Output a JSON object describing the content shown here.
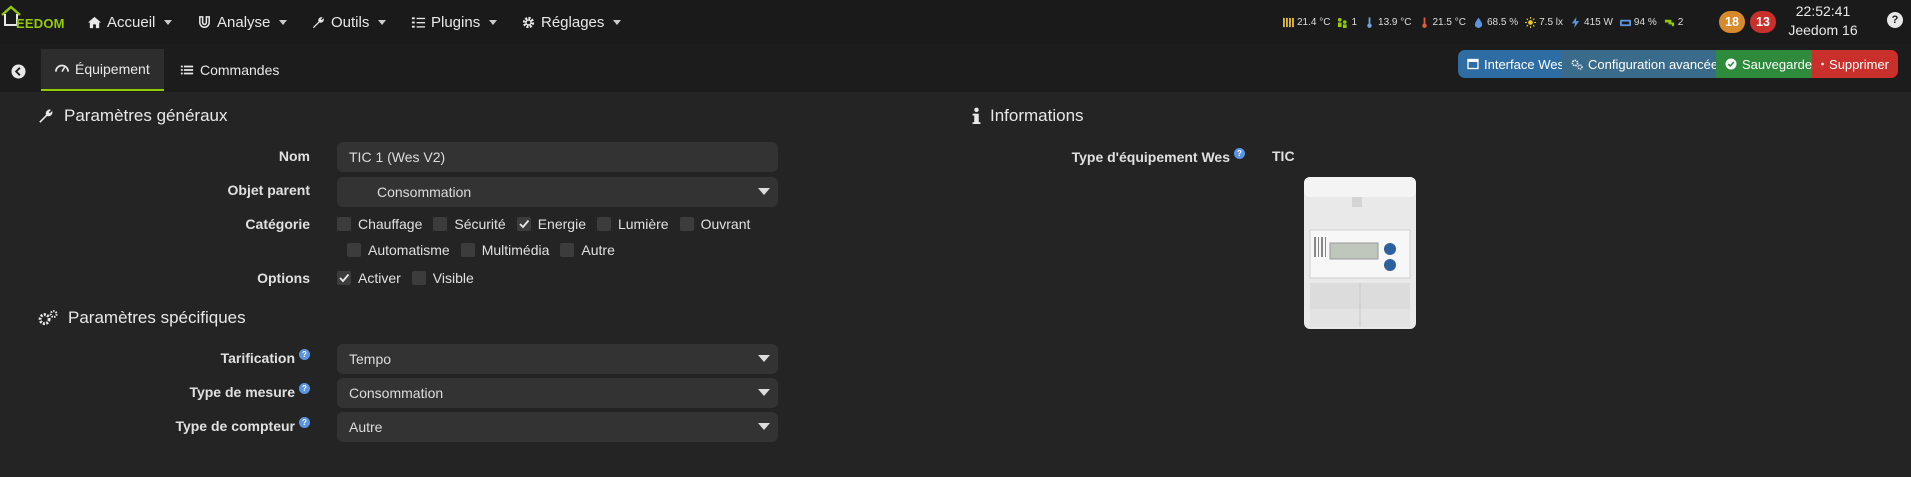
{
  "brand": {
    "logo_prefix": "J",
    "logo_text": "EEDOM"
  },
  "nav": [
    {
      "label": "Accueil",
      "icon": "home-icon"
    },
    {
      "label": "Analyse",
      "icon": "magnet-icon"
    },
    {
      "label": "Outils",
      "icon": "wrench-icon"
    },
    {
      "label": "Plugins",
      "icon": "tasks-icon"
    },
    {
      "label": "Réglages",
      "icon": "gear-icon"
    }
  ],
  "widgets": [
    {
      "icon": "radiator-icon",
      "value": "21.4 °C"
    },
    {
      "icon": "people-icon",
      "value": "1"
    },
    {
      "icon": "thermometer-icon",
      "value": "13.9 °C"
    },
    {
      "icon": "thermometer-icon",
      "value": "21.5 °C"
    },
    {
      "icon": "drop-icon",
      "value": "68.5 %"
    },
    {
      "icon": "sun-icon",
      "value": "7.5 lx"
    },
    {
      "icon": "bolt-icon",
      "value": "415 W"
    },
    {
      "icon": "gauge-icon",
      "value": "94 %"
    },
    {
      "icon": "tap-icon",
      "value": "2"
    }
  ],
  "badges": {
    "orange": "18",
    "red": "13"
  },
  "clock": {
    "time": "22:52:41",
    "name": "Jeedom 16"
  },
  "help_glyph": "?",
  "tabs": {
    "equipement": "Équipement",
    "commandes": "Commandes"
  },
  "actions": {
    "interface": "Interface Wes",
    "config": "Configuration avancée",
    "save": "Sauvegarder",
    "delete": "Supprimer"
  },
  "general": {
    "legend": "Paramètres généraux",
    "nom_label": "Nom",
    "nom_value": "TIC 1 (Wes V2)",
    "parent_label": "Objet parent",
    "parent_value": "Consommation",
    "categorie_label": "Catégorie",
    "categories_row1": [
      {
        "label": "Chauffage",
        "checked": false
      },
      {
        "label": "Sécurité",
        "checked": false
      },
      {
        "label": "Energie",
        "checked": true
      },
      {
        "label": "Lumière",
        "checked": false
      },
      {
        "label": "Ouvrant",
        "checked": false
      }
    ],
    "categories_row2": [
      {
        "label": "Automatisme",
        "checked": false
      },
      {
        "label": "Multimédia",
        "checked": false
      },
      {
        "label": "Autre",
        "checked": false
      }
    ],
    "options_label": "Options",
    "options": [
      {
        "label": "Activer",
        "checked": true
      },
      {
        "label": "Visible",
        "checked": false
      }
    ]
  },
  "specific": {
    "legend": "Paramètres spécifiques",
    "tarif_label": "Tarification",
    "tarif_value": "Tempo",
    "mesure_label": "Type de mesure",
    "mesure_value": "Consommation",
    "compteur_label": "Type de compteur",
    "compteur_value": "Autre"
  },
  "info": {
    "legend": "Informations",
    "type_label": "Type d'équipement Wes",
    "type_value": "TIC"
  },
  "colors": {
    "accent": "#94ca02",
    "primary": "#2e6da4",
    "info_btn": "#3a6b8a",
    "success": "#2e8b3c",
    "danger": "#c9302c",
    "badge_orange": "#d8892b",
    "badge_red": "#c9302c"
  }
}
